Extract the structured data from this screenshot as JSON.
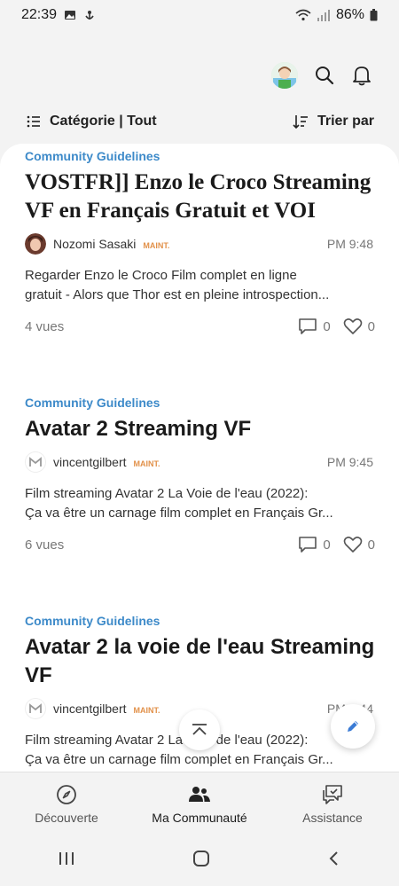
{
  "status_bar": {
    "time": "22:39",
    "battery": "86%",
    "icons_left": [
      "image-icon",
      "notification-icon"
    ],
    "icons_right": [
      "wifi-icon",
      "signal-icon",
      "battery-icon"
    ]
  },
  "header": {
    "icons": [
      "profile-avatar",
      "search-icon",
      "bell-icon"
    ]
  },
  "toolbar": {
    "category_label": "Catégorie | Tout",
    "sort_label": "Trier par"
  },
  "posts": [
    {
      "category": "Community Guidelines",
      "title": "VOSTFR]] Enzo le Croco Streaming VF en Français Gratuit et VOI",
      "author": "Nozomi Sasaki",
      "badge": "MAINT.",
      "time": "PM 9:48",
      "excerpt_line1": "Regarder Enzo le Croco Film complet en ligne",
      "excerpt_line2": "gratuit - Alors que Thor est en pleine introspection...",
      "views": "4 vues",
      "comments": "0",
      "likes": "0"
    },
    {
      "category": "Community Guidelines",
      "title": "Avatar 2 Streaming VF",
      "author": "vincentgilbert",
      "badge": "MAINT.",
      "time": "PM 9:45",
      "excerpt_line1": "Film streaming Avatar 2 La Voie de l'eau (2022):",
      "excerpt_line2": "Ça va être un carnage film complet en Français Gr...",
      "views": "6 vues",
      "comments": "0",
      "likes": "0"
    },
    {
      "category": "Community Guidelines",
      "title": "Avatar 2 la voie de l'eau Streaming VF",
      "author": "vincentgilbert",
      "badge": "MAINT.",
      "time": "PM 9:44",
      "excerpt_line1": "Film streaming Avatar 2 La Voie de l'eau (2022):",
      "excerpt_line2": "Ça va être un carnage film complet en Français Gr..."
    }
  ],
  "bottom_nav": [
    {
      "label": "Découverte",
      "icon": "compass-icon"
    },
    {
      "label": "Ma Communauté",
      "icon": "people-icon"
    },
    {
      "label": "Assistance",
      "icon": "chat-support-icon"
    }
  ],
  "colors": {
    "accent": "#3d8ac9",
    "badge": "#e2914a",
    "fab_icon": "#3a7bd5"
  }
}
